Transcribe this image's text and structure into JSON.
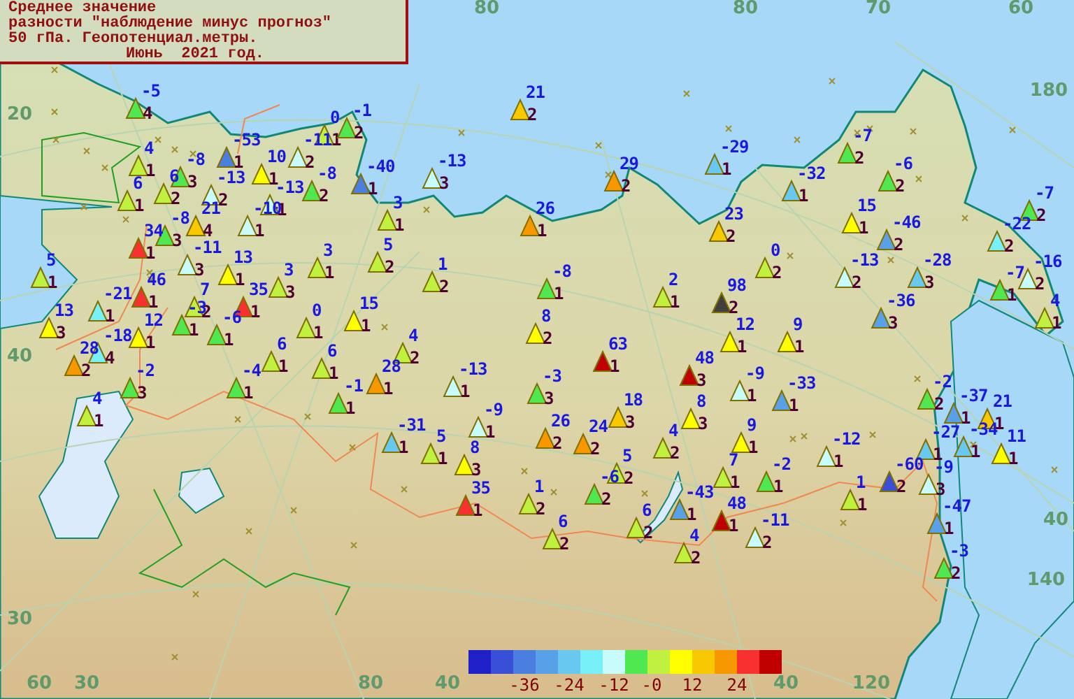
{
  "title": {
    "lines": [
      "Среднее значение",
      "разности \"наблюдение минус прогноз\"",
      "50 гПа. Геопотенциал.метры.",
      "Июнь  2021 год."
    ]
  },
  "grid_labels": [
    "20",
    "80",
    "80",
    "70",
    "60",
    "180",
    "40",
    "30",
    "60",
    "30",
    "80",
    "40",
    "40",
    "140",
    "40",
    "120"
  ],
  "stations": [
    {
      "value": "-5",
      "count": "4",
      "color": "#50e850"
    },
    {
      "value": "4",
      "count": "1",
      "color": "#c0f040"
    },
    {
      "value": "-8",
      "count": "3",
      "color": "#50e850"
    },
    {
      "value": "-53",
      "count": "1",
      "color": "#4a7ee0"
    },
    {
      "value": "10",
      "count": "1",
      "color": "#ffff00"
    },
    {
      "value": "0",
      "count": "1",
      "color": "#c0f040"
    },
    {
      "value": "-1",
      "count": "2",
      "color": "#50e850"
    },
    {
      "value": "-11",
      "count": "2",
      "color": "#c8fcfc"
    },
    {
      "value": "6",
      "count": "1",
      "color": "#c0f040"
    },
    {
      "value": "6",
      "count": "2",
      "color": "#c0f040"
    },
    {
      "value": "-13",
      "count": "2",
      "color": "#c8fcfc"
    },
    {
      "value": "-13",
      "count": "1",
      "color": "#c8fcfc"
    },
    {
      "value": "-8",
      "count": "2",
      "color": "#50e850"
    },
    {
      "value": "-40",
      "count": "1",
      "color": "#4a7ee0"
    },
    {
      "value": "-8",
      "count": "3",
      "color": "#50e850"
    },
    {
      "value": "21",
      "count": "4",
      "color": "#f8c800"
    },
    {
      "value": "-10",
      "count": "1",
      "color": "#c8fcfc"
    },
    {
      "value": "34",
      "count": "1",
      "color": "#f83030"
    },
    {
      "value": "-11",
      "count": "3",
      "color": "#c8fcfc"
    },
    {
      "value": "13",
      "count": "1",
      "color": "#ffff00"
    },
    {
      "value": "3",
      "count": "1",
      "color": "#c0f040"
    },
    {
      "value": "5",
      "count": "1",
      "color": "#c0f040"
    },
    {
      "value": "3",
      "count": "3",
      "color": "#c0f040"
    },
    {
      "value": "46",
      "count": "1",
      "color": "#f83030"
    },
    {
      "value": "-21",
      "count": "1",
      "color": "#78f0f8"
    },
    {
      "value": "7",
      "count": "2",
      "color": "#c0f040"
    },
    {
      "value": "35",
      "count": "1",
      "color": "#f83030"
    },
    {
      "value": "13",
      "count": "3",
      "color": "#ffff00"
    },
    {
      "value": "12",
      "count": "1",
      "color": "#ffff00"
    },
    {
      "value": "-3",
      "count": "1",
      "color": "#50e850"
    },
    {
      "value": "-6",
      "count": "1",
      "color": "#50e850"
    },
    {
      "value": "0",
      "count": "1",
      "color": "#c0f040"
    },
    {
      "value": "15",
      "count": "1",
      "color": "#ffff00"
    },
    {
      "value": "-18",
      "count": "4",
      "color": "#78f0f8"
    },
    {
      "value": "28",
      "count": "2",
      "color": "#f89800"
    },
    {
      "value": "-2",
      "count": "3",
      "color": "#50e850"
    },
    {
      "value": "4",
      "count": "1",
      "color": "#c0f040"
    },
    {
      "value": "-4",
      "count": "1",
      "color": "#50e850"
    },
    {
      "value": "6",
      "count": "1",
      "color": "#c0f040"
    },
    {
      "value": "6",
      "count": "1",
      "color": "#c0f040"
    },
    {
      "value": "-1",
      "count": "1",
      "color": "#50e850"
    },
    {
      "value": "21",
      "count": "2",
      "color": "#f8c800"
    },
    {
      "value": "-13",
      "count": "3",
      "color": "#c8fcfc"
    },
    {
      "value": "3",
      "count": "1",
      "color": "#c0f040"
    },
    {
      "value": "29",
      "count": "2",
      "color": "#f89800"
    },
    {
      "value": "26",
      "count": "1",
      "color": "#f89800"
    },
    {
      "value": "5",
      "count": "2",
      "color": "#c0f040"
    },
    {
      "value": "1",
      "count": "2",
      "color": "#c0f040"
    },
    {
      "value": "-8",
      "count": "1",
      "color": "#50e850"
    },
    {
      "value": "2",
      "count": "1",
      "color": "#c0f040"
    },
    {
      "value": "8",
      "count": "2",
      "color": "#ffff00"
    },
    {
      "value": "4",
      "count": "2",
      "color": "#c0f040"
    },
    {
      "value": "-29",
      "count": "1",
      "color": "#68c8f0"
    },
    {
      "value": "-7",
      "count": "2",
      "color": "#50e850"
    },
    {
      "value": "-32",
      "count": "1",
      "color": "#68c8f0"
    },
    {
      "value": "-6",
      "count": "2",
      "color": "#50e850"
    },
    {
      "value": "23",
      "count": "2",
      "color": "#f8c800"
    },
    {
      "value": "15",
      "count": "1",
      "color": "#ffff00"
    },
    {
      "value": "-46",
      "count": "2",
      "color": "#58a0e8"
    },
    {
      "value": "-7",
      "count": "2",
      "color": "#50e850"
    },
    {
      "value": "-22",
      "count": "2",
      "color": "#78f0f8"
    },
    {
      "value": "0",
      "count": "2",
      "color": "#c0f040"
    },
    {
      "value": "-13",
      "count": "2",
      "color": "#c8fcfc"
    },
    {
      "value": "-28",
      "count": "3",
      "color": "#68c8f0"
    },
    {
      "value": "-16",
      "count": "2",
      "color": "#c8fcfc"
    },
    {
      "value": "-7",
      "count": "1",
      "color": "#50e850"
    },
    {
      "value": "98",
      "count": "2",
      "color": "#404040"
    },
    {
      "value": "-36",
      "count": "3",
      "color": "#58a0e8"
    },
    {
      "value": "4",
      "count": "1",
      "color": "#c0f040"
    },
    {
      "value": "12",
      "count": "1",
      "color": "#ffff00"
    },
    {
      "value": "9",
      "count": "1",
      "color": "#ffff00"
    },
    {
      "value": "63",
      "count": "1",
      "color": "#c00000"
    },
    {
      "value": "28",
      "count": "1",
      "color": "#f89800"
    },
    {
      "value": "-13",
      "count": "1",
      "color": "#c8fcfc"
    },
    {
      "value": "-3",
      "count": "3",
      "color": "#50e850"
    },
    {
      "value": "48",
      "count": "3",
      "color": "#c00000"
    },
    {
      "value": "-9",
      "count": "1",
      "color": "#c8fcfc"
    },
    {
      "value": "18",
      "count": "3",
      "color": "#f8c800"
    },
    {
      "value": "8",
      "count": "3",
      "color": "#ffff00"
    },
    {
      "value": "-31",
      "count": "1",
      "color": "#68c8f0"
    },
    {
      "value": "5",
      "count": "1",
      "color": "#c0f040"
    },
    {
      "value": "26",
      "count": "2",
      "color": "#f89800"
    },
    {
      "value": "24",
      "count": "2",
      "color": "#f89800"
    },
    {
      "value": "4",
      "count": "2",
      "color": "#c0f040"
    },
    {
      "value": "8",
      "count": "3",
      "color": "#ffff00"
    },
    {
      "value": "5",
      "count": "2",
      "color": "#c0f040"
    },
    {
      "value": "35",
      "count": "1",
      "color": "#f83030"
    },
    {
      "value": "1",
      "count": "2",
      "color": "#c0f040"
    },
    {
      "value": "-6",
      "count": "2",
      "color": "#50e850"
    },
    {
      "value": "-43",
      "count": "1",
      "color": "#58a0e8"
    },
    {
      "value": "6",
      "count": "2",
      "color": "#c0f040"
    },
    {
      "value": "6",
      "count": "2",
      "color": "#c0f040"
    },
    {
      "value": "4",
      "count": "2",
      "color": "#c0f040"
    },
    {
      "value": "-9",
      "count": "1",
      "color": "#c8fcfc"
    },
    {
      "value": "-33",
      "count": "1",
      "color": "#58a0e8"
    },
    {
      "value": "9",
      "count": "1",
      "color": "#ffff00"
    },
    {
      "value": "-12",
      "count": "1",
      "color": "#c8fcfc"
    },
    {
      "value": "7",
      "count": "1",
      "color": "#c0f040"
    },
    {
      "value": "-2",
      "count": "1",
      "color": "#50e850"
    },
    {
      "value": "1",
      "count": "1",
      "color": "#c0f040"
    },
    {
      "value": "48",
      "count": "1",
      "color": "#c00000"
    },
    {
      "value": "-11",
      "count": "2",
      "color": "#c8fcfc"
    },
    {
      "value": "-2",
      "count": "2",
      "color": "#50e850"
    },
    {
      "value": "-37",
      "count": "1",
      "color": "#58a0e8"
    },
    {
      "value": "21",
      "count": "1",
      "color": "#f8c800"
    },
    {
      "value": "-27",
      "count": "1",
      "color": "#68c8f0"
    },
    {
      "value": "-34",
      "count": "1",
      "color": "#68c8f0"
    },
    {
      "value": "11",
      "count": "1",
      "color": "#ffff00"
    },
    {
      "value": "-60",
      "count": "2",
      "color": "#3a4fd8"
    },
    {
      "value": "-9",
      "count": "3",
      "color": "#c8fcfc"
    },
    {
      "value": "-47",
      "count": "1",
      "color": "#58a0e8"
    },
    {
      "value": "-3",
      "count": "2",
      "color": "#50e850"
    }
  ],
  "legend": {
    "swatches": [
      {
        "color": "#2020c8"
      },
      {
        "color": "#3a4fd8"
      },
      {
        "color": "#4a7ee0"
      },
      {
        "color": "#58a0e8"
      },
      {
        "color": "#68c8f0"
      },
      {
        "color": "#78f0f8"
      },
      {
        "color": "#c8fcfc"
      },
      {
        "color": "#50e850"
      },
      {
        "color": "#c0f040"
      },
      {
        "color": "#ffff00"
      },
      {
        "color": "#f8c800"
      },
      {
        "color": "#f89800"
      },
      {
        "color": "#f83030"
      },
      {
        "color": "#c00000"
      }
    ],
    "labels": [
      "-36",
      "-24",
      "-12",
      "-0",
      "12",
      "24"
    ]
  }
}
